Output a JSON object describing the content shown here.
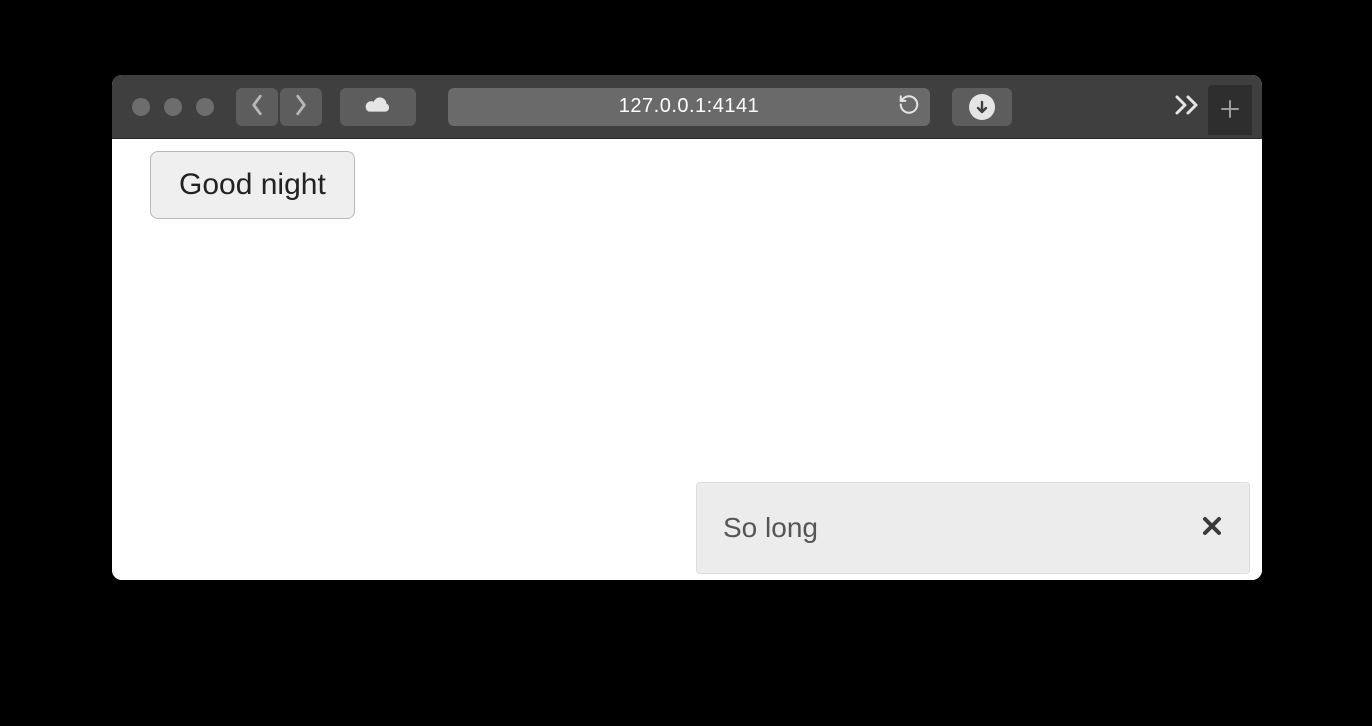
{
  "browser": {
    "address": "127.0.0.1:4141"
  },
  "page": {
    "button_label": "Good night"
  },
  "toast": {
    "message": "So long"
  }
}
